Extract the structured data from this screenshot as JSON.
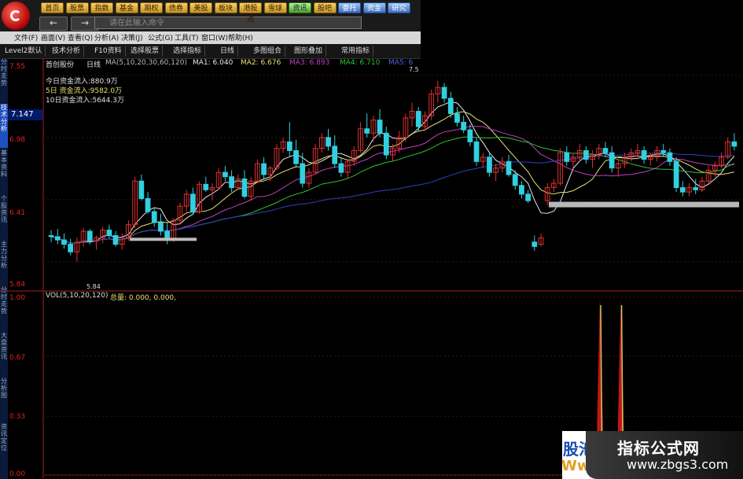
{
  "toolbar": {
    "buttons": [
      "首页",
      "股票",
      "指数",
      "基金",
      "期权",
      "债券",
      "美股",
      "板块",
      "港股通",
      "雪球",
      "资讯",
      "股吧",
      "委托",
      "资金",
      "研究"
    ],
    "command_placeholder": "请在此输入命令",
    "nav_back": "←",
    "nav_forward": "→"
  },
  "menu": {
    "items": [
      "文件(F)",
      "画面(V)",
      "查看(Q)",
      "分析(A)",
      "决策(J)",
      "公式(G)",
      "工具(T)",
      "窗口(W)",
      "帮助(H)"
    ]
  },
  "tabs": {
    "items": [
      "Level2默认",
      "技术分析",
      "F10资料",
      "选择股票",
      "选择指标",
      "日线",
      "多图组合",
      "图形叠加",
      "常用指标"
    ]
  },
  "side_tabs": [
    "分时走势",
    "技术分析",
    "基本资料",
    "个股资讯",
    "主力分析",
    "分时走势",
    "大盘资讯",
    "分析图",
    "资讯定位"
  ],
  "header": {
    "stock": "首创股份",
    "period": "日线",
    "ma_label": "MA(5,10,20,30,60,120)",
    "ma1": "MA1: 6.040",
    "ma2": "MA2: 6.676",
    "ma3": "MA3: 6.893",
    "ma4": "MA4: 6.710",
    "ma5": "MA5: 6"
  },
  "flows": {
    "today": "今日资金流入:880.9万",
    "d5": "5日 资金流入:9582.0万",
    "d10": "10日资金流入:5644.3万"
  },
  "price_axis": {
    "ticks": [
      "7.55",
      "6.98",
      "6.41",
      "5.84"
    ],
    "current": "7.147",
    "low_marker": "5.84",
    "high_marker": "7.5"
  },
  "volume": {
    "label": "VOL(5,10,20,120)",
    "total": "总量: 0.000, 0.000,",
    "ticks": [
      "1.00",
      "0.67",
      "0.33",
      "0.00"
    ]
  },
  "watermark": {
    "text1": "指标公式网",
    "text2": "www.zbgs3.com",
    "left1": "股池",
    "left2": "Ww"
  },
  "colors": {
    "up": "#e03030",
    "down": "#30d0e0",
    "ma5": "#e8e8e8",
    "ma10": "#e8e070",
    "ma20": "#c040c0",
    "ma30": "#30c030",
    "ma60": "#3040c0",
    "ma120": "#d0d0d0"
  },
  "chart_data": {
    "type": "candlestick",
    "title": "首创股份 日线",
    "ylim": [
      5.6,
      7.65
    ],
    "y_ticks": [
      7.55,
      6.98,
      6.41,
      5.84
    ],
    "candles": [
      [
        6.08,
        6.13,
        6.02,
        6.07
      ],
      [
        6.07,
        6.14,
        6.0,
        6.04
      ],
      [
        6.04,
        6.1,
        5.96,
        6.0
      ],
      [
        6.0,
        6.05,
        5.9,
        5.93
      ],
      [
        5.93,
        6.06,
        5.84,
        6.02
      ],
      [
        6.02,
        6.15,
        5.98,
        6.12
      ],
      [
        6.12,
        6.14,
        6.0,
        6.03
      ],
      [
        6.03,
        6.08,
        5.95,
        6.06
      ],
      [
        6.06,
        6.16,
        6.01,
        6.13
      ],
      [
        6.13,
        6.18,
        6.05,
        6.08
      ],
      [
        6.08,
        6.12,
        5.98,
        6.0
      ],
      [
        6.0,
        6.1,
        5.95,
        6.06
      ],
      [
        6.06,
        6.22,
        6.03,
        6.18
      ],
      [
        6.18,
        6.62,
        6.15,
        6.58
      ],
      [
        6.58,
        6.64,
        6.4,
        6.42
      ],
      [
        6.42,
        6.48,
        6.28,
        6.3
      ],
      [
        6.3,
        6.34,
        6.16,
        6.2
      ],
      [
        6.2,
        6.28,
        6.08,
        6.12
      ],
      [
        6.12,
        6.2,
        6.0,
        6.05
      ],
      [
        6.05,
        6.24,
        6.02,
        6.22
      ],
      [
        6.22,
        6.38,
        6.18,
        6.35
      ],
      [
        6.35,
        6.5,
        6.3,
        6.46
      ],
      [
        6.46,
        6.52,
        6.28,
        6.3
      ],
      [
        6.3,
        6.58,
        6.28,
        6.55
      ],
      [
        6.55,
        6.62,
        6.48,
        6.5
      ],
      [
        6.5,
        6.56,
        6.4,
        6.52
      ],
      [
        6.52,
        6.7,
        6.5,
        6.66
      ],
      [
        6.66,
        6.72,
        6.58,
        6.62
      ],
      [
        6.62,
        6.68,
        6.48,
        6.52
      ],
      [
        6.52,
        6.64,
        6.5,
        6.6
      ],
      [
        6.6,
        6.68,
        6.42,
        6.44
      ],
      [
        6.44,
        6.62,
        6.4,
        6.58
      ],
      [
        6.58,
        6.78,
        6.56,
        6.74
      ],
      [
        6.74,
        6.8,
        6.6,
        6.64
      ],
      [
        6.64,
        6.72,
        6.58,
        6.7
      ],
      [
        6.7,
        6.92,
        6.68,
        6.88
      ],
      [
        6.88,
        6.98,
        6.84,
        6.94
      ],
      [
        6.94,
        7.12,
        6.8,
        6.86
      ],
      [
        6.86,
        6.96,
        6.7,
        6.74
      ],
      [
        6.74,
        6.84,
        6.52,
        6.56
      ],
      [
        6.56,
        6.7,
        6.52,
        6.66
      ],
      [
        6.66,
        6.92,
        6.64,
        6.88
      ],
      [
        6.88,
        7.02,
        6.84,
        6.98
      ],
      [
        6.98,
        7.06,
        6.86,
        6.9
      ],
      [
        6.9,
        7.0,
        6.7,
        6.74
      ],
      [
        6.74,
        6.8,
        6.62,
        6.66
      ],
      [
        6.66,
        6.78,
        6.6,
        6.76
      ],
      [
        6.76,
        6.9,
        6.72,
        6.86
      ],
      [
        6.86,
        7.12,
        6.84,
        7.06
      ],
      [
        7.06,
        7.2,
        6.98,
        7.02
      ],
      [
        7.02,
        7.18,
        6.94,
        7.14
      ],
      [
        7.14,
        7.24,
        6.98,
        7.02
      ],
      [
        7.02,
        7.08,
        6.78,
        6.82
      ],
      [
        6.82,
        6.92,
        6.76,
        6.88
      ],
      [
        6.88,
        7.04,
        6.84,
        6.98
      ],
      [
        6.98,
        7.2,
        6.94,
        7.16
      ],
      [
        7.16,
        7.3,
        7.08,
        7.22
      ],
      [
        7.22,
        7.26,
        7.04,
        7.08
      ],
      [
        7.08,
        7.22,
        7.04,
        7.18
      ],
      [
        7.18,
        7.42,
        7.14,
        7.38
      ],
      [
        7.38,
        7.5,
        7.3,
        7.44
      ],
      [
        7.44,
        7.48,
        7.3,
        7.34
      ],
      [
        7.34,
        7.4,
        7.16,
        7.2
      ],
      [
        7.2,
        7.26,
        7.08,
        7.12
      ],
      [
        7.12,
        7.18,
        7.02,
        7.05
      ],
      [
        7.05,
        7.1,
        6.9,
        6.94
      ],
      [
        6.94,
        6.98,
        6.72,
        6.76
      ],
      [
        6.76,
        6.84,
        6.7,
        6.8
      ],
      [
        6.8,
        6.84,
        6.62,
        6.66
      ],
      [
        6.66,
        6.74,
        6.58,
        6.7
      ],
      [
        6.7,
        6.8,
        6.66,
        6.76
      ],
      [
        6.76,
        6.82,
        6.62,
        6.64
      ],
      [
        6.64,
        6.68,
        6.5,
        6.54
      ],
      [
        6.54,
        6.58,
        6.42,
        6.46
      ],
      [
        6.46,
        6.5,
        6.38,
        6.4
      ],
      [
        6.02,
        6.08,
        5.94,
        5.98
      ],
      [
        6.0,
        6.1,
        5.98,
        6.06
      ],
      [
        6.4,
        6.56,
        6.36,
        6.52
      ],
      [
        6.52,
        6.6,
        6.48,
        6.56
      ],
      [
        6.56,
        6.88,
        6.54,
        6.84
      ],
      [
        6.84,
        6.9,
        6.72,
        6.76
      ],
      [
        6.76,
        6.84,
        6.7,
        6.8
      ],
      [
        6.8,
        6.92,
        6.76,
        6.86
      ],
      [
        6.86,
        6.9,
        6.74,
        6.78
      ],
      [
        6.78,
        6.86,
        6.7,
        6.82
      ],
      [
        6.82,
        6.92,
        6.78,
        6.88
      ],
      [
        6.88,
        6.94,
        6.8,
        6.84
      ],
      [
        6.84,
        6.9,
        6.66,
        6.7
      ],
      [
        6.7,
        6.78,
        6.62,
        6.74
      ],
      [
        6.74,
        6.84,
        6.7,
        6.8
      ],
      [
        6.8,
        6.88,
        6.76,
        6.84
      ],
      [
        6.84,
        6.92,
        6.78,
        6.86
      ],
      [
        6.86,
        6.9,
        6.74,
        6.78
      ],
      [
        6.78,
        6.84,
        6.72,
        6.8
      ],
      [
        6.8,
        6.9,
        6.76,
        6.86
      ],
      [
        6.86,
        6.92,
        6.8,
        6.84
      ],
      [
        6.84,
        6.88,
        6.72,
        6.76
      ],
      [
        6.76,
        6.8,
        6.48,
        6.52
      ],
      [
        6.52,
        6.58,
        6.44,
        6.48
      ],
      [
        6.48,
        6.56,
        6.44,
        6.52
      ],
      [
        6.52,
        6.6,
        6.46,
        6.5
      ],
      [
        6.5,
        6.62,
        6.48,
        6.58
      ],
      [
        6.58,
        6.72,
        6.56,
        6.68
      ],
      [
        6.68,
        6.76,
        6.62,
        6.72
      ],
      [
        6.72,
        6.84,
        6.7,
        6.8
      ],
      [
        6.8,
        6.98,
        6.78,
        6.94
      ],
      [
        6.94,
        7.02,
        6.86,
        6.9
      ]
    ],
    "volume": {
      "ylim": [
        0,
        1.0
      ],
      "ticks": [
        1.0,
        0.67,
        0.33,
        0.0
      ],
      "spike_positions": [
        0.8,
        0.83
      ],
      "spike_value": 1.0
    },
    "series": [
      {
        "name": "MA1",
        "color": "#e8e8e8"
      },
      {
        "name": "MA2",
        "color": "#e8e070"
      },
      {
        "name": "MA3",
        "color": "#c040c0"
      },
      {
        "name": "MA4",
        "color": "#30c030"
      },
      {
        "name": "MA5",
        "color": "#3040c0"
      }
    ]
  }
}
